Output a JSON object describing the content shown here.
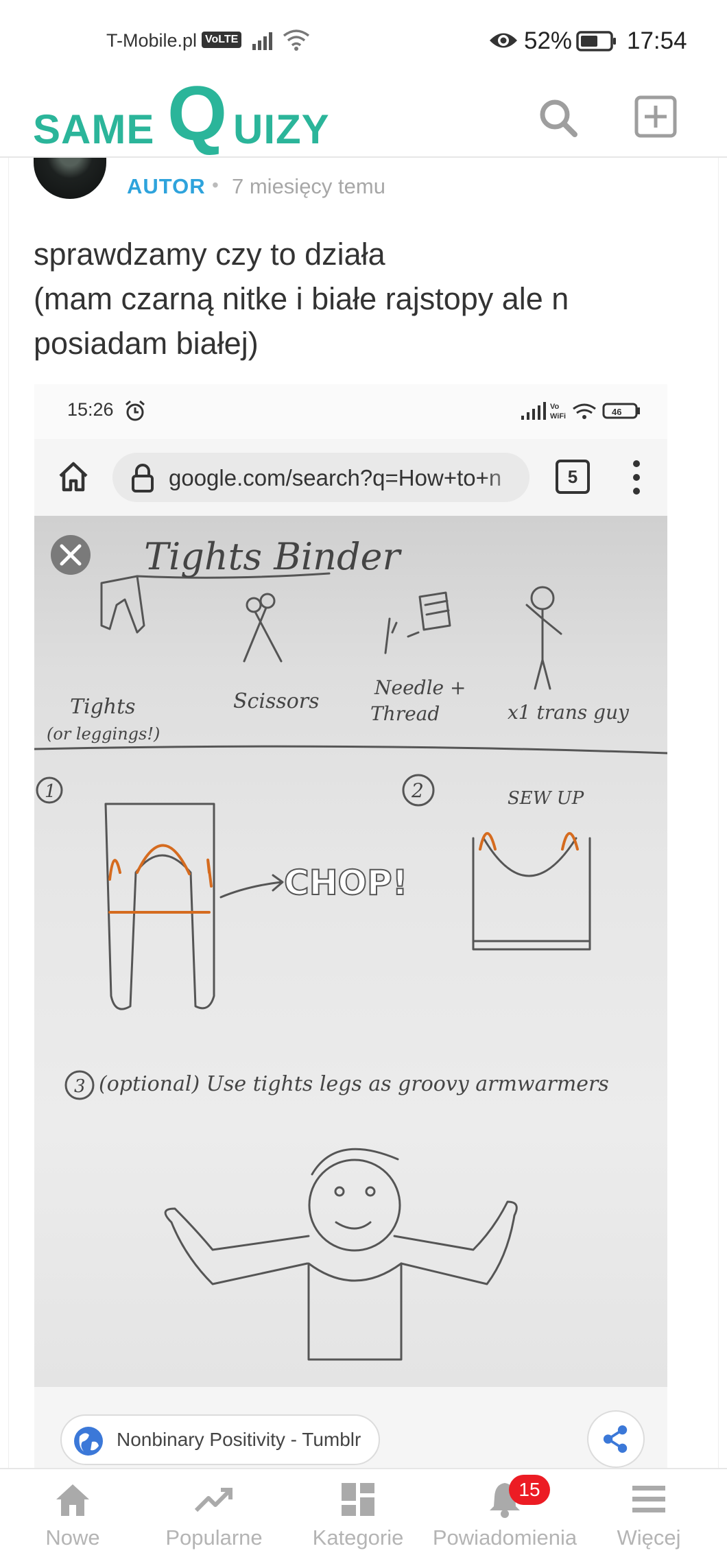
{
  "status_bar": {
    "carrier": "T-Mobile.pl",
    "volte": "VoLTE",
    "battery_percent": "52%",
    "time": "17:54"
  },
  "header": {
    "logo_same": "SAME",
    "logo_q": "Q",
    "logo_rest": "UIZY",
    "brand_color": "#2bb59a",
    "icons": [
      "search-icon",
      "add-square-icon"
    ]
  },
  "post": {
    "author_badge": "AUTOR",
    "separator": "•",
    "time_ago": "7 miesięcy temu",
    "text_lines": [
      "sprawdzamy czy to działa",
      "(mam czarną nitke i białe rajstopy ale n",
      "posiadam białej)"
    ],
    "badge_color": "#2ea3dc"
  },
  "embedded_screenshot": {
    "status_time": "15:26",
    "battery": "46",
    "url": "google.com/search?q=How+to+n",
    "tabs_count": "5",
    "drawing": {
      "title": "Tights Binder",
      "item_1": "Tights",
      "item_1_sub": "(or leggings!)",
      "item_2": "Scissors",
      "item_3a": "Needle +",
      "item_3b": "Thread",
      "item_4": "x1 trans guy",
      "step_1": "1",
      "step_2": "2",
      "step_3": "3",
      "chop": "CHOP!",
      "sew_up": "SEW UP",
      "optional": "(optional) Use tights legs as groovy armwarmers"
    },
    "source": "Nonbinary Positivity - Tumblr"
  },
  "bottom_nav": {
    "items": [
      {
        "label": "Nowe",
        "icon": "home-icon"
      },
      {
        "label": "Popularne",
        "icon": "trending-icon"
      },
      {
        "label": "Kategorie",
        "icon": "grid-icon"
      },
      {
        "label": "Powiadomienia",
        "icon": "bell-icon",
        "badge": "15"
      },
      {
        "label": "Więcej",
        "icon": "menu-icon"
      }
    ],
    "badge_color": "#ec1c24"
  }
}
